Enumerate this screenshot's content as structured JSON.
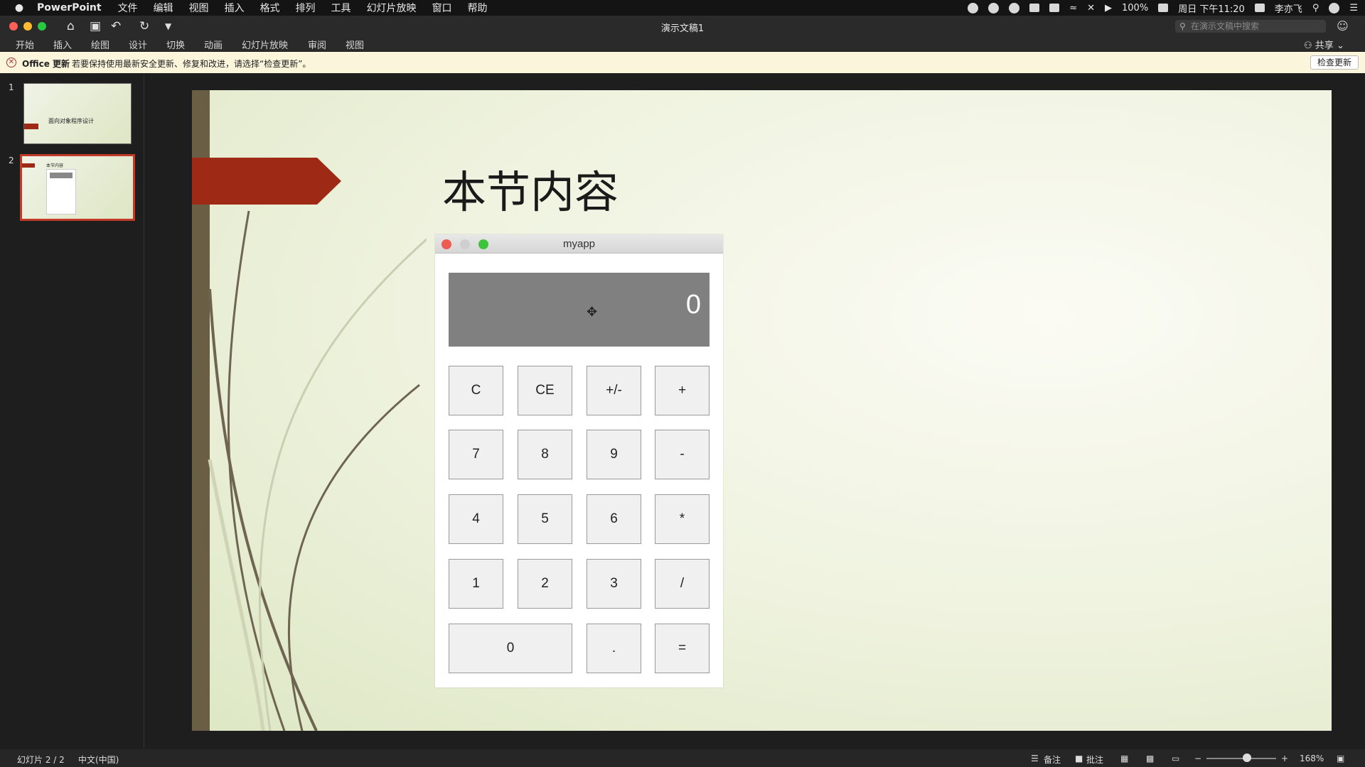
{
  "menubar": {
    "app": "PowerPoint",
    "items": [
      "文件",
      "编辑",
      "视图",
      "插入",
      "格式",
      "排列",
      "工具",
      "幻灯片放映",
      "窗口",
      "帮助"
    ],
    "battery": "100%",
    "datetime": "周日 下午11:20",
    "user": "李亦飞"
  },
  "window": {
    "title": "演示文稿1",
    "search_placeholder": "在演示文稿中搜索"
  },
  "ribbon": {
    "tabs": [
      "开始",
      "插入",
      "绘图",
      "设计",
      "切换",
      "动画",
      "幻灯片放映",
      "审阅",
      "视图"
    ],
    "share": "共享"
  },
  "notification": {
    "label": "Office 更新",
    "message": "若要保持使用最新安全更新、修复和改进，请选择“检查更新”。",
    "button": "检查更新"
  },
  "thumbnails": [
    {
      "number": "1",
      "title": "面向对象程序设计"
    },
    {
      "number": "2",
      "title": "本节内容"
    }
  ],
  "slide": {
    "title": "本节内容"
  },
  "calculator": {
    "title": "myapp",
    "display": "0",
    "keys": [
      "C",
      "CE",
      "+/-",
      "+",
      "7",
      "8",
      "9",
      "-",
      "4",
      "5",
      "6",
      "*",
      "1",
      "2",
      "3",
      "/",
      "0",
      ".",
      "="
    ]
  },
  "statusbar": {
    "slide_info": "幻灯片 2 / 2",
    "language": "中文(中国)",
    "notes": "备注",
    "comments": "批注",
    "zoom": "168%"
  }
}
